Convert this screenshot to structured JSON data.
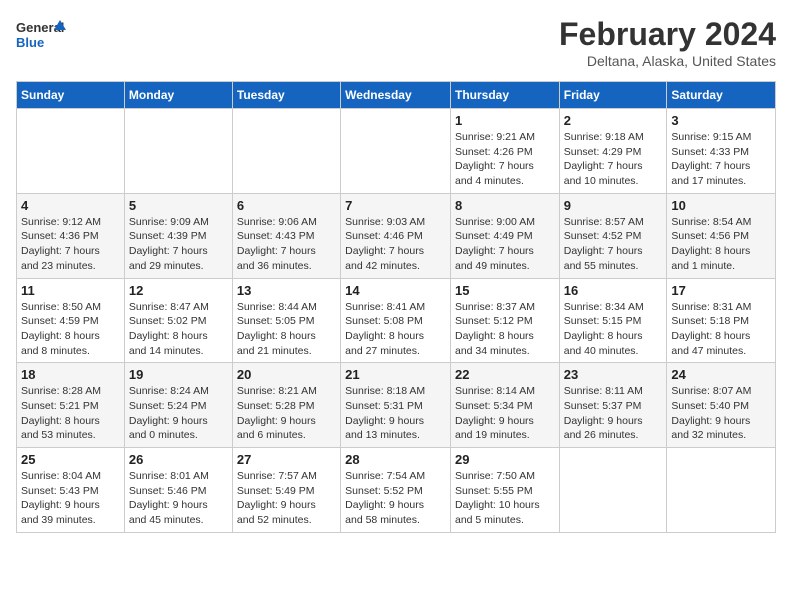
{
  "logo": {
    "line1": "General",
    "line2": "Blue"
  },
  "title": "February 2024",
  "subtitle": "Deltana, Alaska, United States",
  "weekdays": [
    "Sunday",
    "Monday",
    "Tuesday",
    "Wednesday",
    "Thursday",
    "Friday",
    "Saturday"
  ],
  "weeks": [
    [
      {
        "day": "",
        "info": ""
      },
      {
        "day": "",
        "info": ""
      },
      {
        "day": "",
        "info": ""
      },
      {
        "day": "",
        "info": ""
      },
      {
        "day": "1",
        "info": "Sunrise: 9:21 AM\nSunset: 4:26 PM\nDaylight: 7 hours\nand 4 minutes."
      },
      {
        "day": "2",
        "info": "Sunrise: 9:18 AM\nSunset: 4:29 PM\nDaylight: 7 hours\nand 10 minutes."
      },
      {
        "day": "3",
        "info": "Sunrise: 9:15 AM\nSunset: 4:33 PM\nDaylight: 7 hours\nand 17 minutes."
      }
    ],
    [
      {
        "day": "4",
        "info": "Sunrise: 9:12 AM\nSunset: 4:36 PM\nDaylight: 7 hours\nand 23 minutes."
      },
      {
        "day": "5",
        "info": "Sunrise: 9:09 AM\nSunset: 4:39 PM\nDaylight: 7 hours\nand 29 minutes."
      },
      {
        "day": "6",
        "info": "Sunrise: 9:06 AM\nSunset: 4:43 PM\nDaylight: 7 hours\nand 36 minutes."
      },
      {
        "day": "7",
        "info": "Sunrise: 9:03 AM\nSunset: 4:46 PM\nDaylight: 7 hours\nand 42 minutes."
      },
      {
        "day": "8",
        "info": "Sunrise: 9:00 AM\nSunset: 4:49 PM\nDaylight: 7 hours\nand 49 minutes."
      },
      {
        "day": "9",
        "info": "Sunrise: 8:57 AM\nSunset: 4:52 PM\nDaylight: 7 hours\nand 55 minutes."
      },
      {
        "day": "10",
        "info": "Sunrise: 8:54 AM\nSunset: 4:56 PM\nDaylight: 8 hours\nand 1 minute."
      }
    ],
    [
      {
        "day": "11",
        "info": "Sunrise: 8:50 AM\nSunset: 4:59 PM\nDaylight: 8 hours\nand 8 minutes."
      },
      {
        "day": "12",
        "info": "Sunrise: 8:47 AM\nSunset: 5:02 PM\nDaylight: 8 hours\nand 14 minutes."
      },
      {
        "day": "13",
        "info": "Sunrise: 8:44 AM\nSunset: 5:05 PM\nDaylight: 8 hours\nand 21 minutes."
      },
      {
        "day": "14",
        "info": "Sunrise: 8:41 AM\nSunset: 5:08 PM\nDaylight: 8 hours\nand 27 minutes."
      },
      {
        "day": "15",
        "info": "Sunrise: 8:37 AM\nSunset: 5:12 PM\nDaylight: 8 hours\nand 34 minutes."
      },
      {
        "day": "16",
        "info": "Sunrise: 8:34 AM\nSunset: 5:15 PM\nDaylight: 8 hours\nand 40 minutes."
      },
      {
        "day": "17",
        "info": "Sunrise: 8:31 AM\nSunset: 5:18 PM\nDaylight: 8 hours\nand 47 minutes."
      }
    ],
    [
      {
        "day": "18",
        "info": "Sunrise: 8:28 AM\nSunset: 5:21 PM\nDaylight: 8 hours\nand 53 minutes."
      },
      {
        "day": "19",
        "info": "Sunrise: 8:24 AM\nSunset: 5:24 PM\nDaylight: 9 hours\nand 0 minutes."
      },
      {
        "day": "20",
        "info": "Sunrise: 8:21 AM\nSunset: 5:28 PM\nDaylight: 9 hours\nand 6 minutes."
      },
      {
        "day": "21",
        "info": "Sunrise: 8:18 AM\nSunset: 5:31 PM\nDaylight: 9 hours\nand 13 minutes."
      },
      {
        "day": "22",
        "info": "Sunrise: 8:14 AM\nSunset: 5:34 PM\nDaylight: 9 hours\nand 19 minutes."
      },
      {
        "day": "23",
        "info": "Sunrise: 8:11 AM\nSunset: 5:37 PM\nDaylight: 9 hours\nand 26 minutes."
      },
      {
        "day": "24",
        "info": "Sunrise: 8:07 AM\nSunset: 5:40 PM\nDaylight: 9 hours\nand 32 minutes."
      }
    ],
    [
      {
        "day": "25",
        "info": "Sunrise: 8:04 AM\nSunset: 5:43 PM\nDaylight: 9 hours\nand 39 minutes."
      },
      {
        "day": "26",
        "info": "Sunrise: 8:01 AM\nSunset: 5:46 PM\nDaylight: 9 hours\nand 45 minutes."
      },
      {
        "day": "27",
        "info": "Sunrise: 7:57 AM\nSunset: 5:49 PM\nDaylight: 9 hours\nand 52 minutes."
      },
      {
        "day": "28",
        "info": "Sunrise: 7:54 AM\nSunset: 5:52 PM\nDaylight: 9 hours\nand 58 minutes."
      },
      {
        "day": "29",
        "info": "Sunrise: 7:50 AM\nSunset: 5:55 PM\nDaylight: 10 hours\nand 5 minutes."
      },
      {
        "day": "",
        "info": ""
      },
      {
        "day": "",
        "info": ""
      }
    ]
  ],
  "colors": {
    "header_bg": "#1565c0",
    "header_text": "#ffffff"
  }
}
